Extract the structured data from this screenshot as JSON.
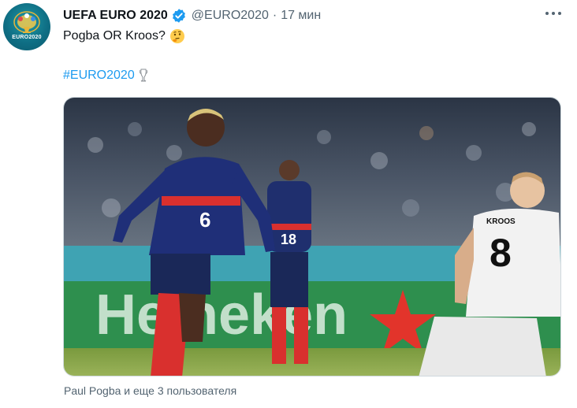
{
  "account": {
    "display_name": "UEFA EURO 2020",
    "handle": "@EURO2020",
    "time": "17 мин",
    "avatar_text": "EURO2020",
    "verified": true
  },
  "tweet": {
    "text": "Pogba OR Kroos?",
    "emoji": "thinking-face",
    "hashtag": "#EURO2020",
    "hashtag_emoji": "trophy"
  },
  "media": {
    "alt": "Pogba and Kroos on the pitch",
    "player_left_number": "6",
    "player_mid_number": "18",
    "player_right_name": "KROOS",
    "player_right_number": "8"
  },
  "tagged": "Paul Pogba и еще 3 пользователя",
  "colors": {
    "accent": "#1d9bf0",
    "text": "#0f1419",
    "secondary": "#536471"
  }
}
